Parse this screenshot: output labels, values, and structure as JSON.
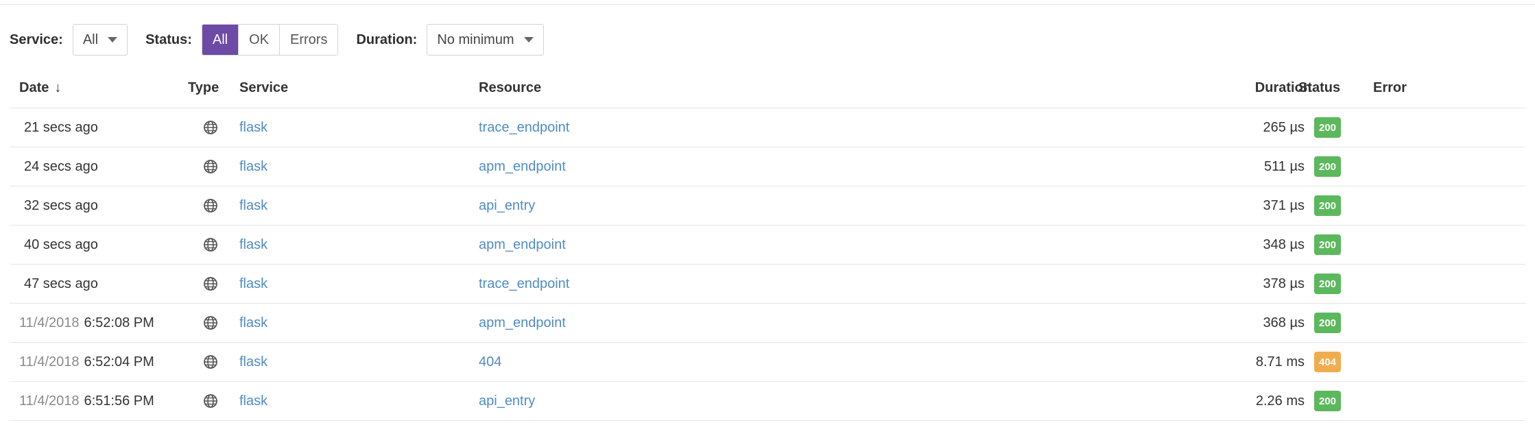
{
  "filters": {
    "service": {
      "label": "Service:",
      "value": "All"
    },
    "status": {
      "label": "Status:",
      "options": [
        "All",
        "OK",
        "Errors"
      ],
      "selected": "All"
    },
    "duration": {
      "label": "Duration:",
      "value": "No minimum"
    }
  },
  "colors": {
    "accent": "#6c4aa5",
    "link": "#4f8bc4",
    "status_ok": "#5cb85c",
    "status_warn": "#f0ad4e"
  },
  "table": {
    "headers": {
      "date": "Date",
      "date_sort": "↓",
      "type": "Type",
      "service": "Service",
      "resource": "Resource",
      "duration": "Duration",
      "status": "Status",
      "error": "Error"
    },
    "rows": [
      {
        "date_prefix": "",
        "date_main": "21 secs ago",
        "type_icon": "globe-icon",
        "service": "flask",
        "resource": "trace_endpoint",
        "duration": "265 µs",
        "status": "200",
        "status_color": "#5cb85c",
        "error": ""
      },
      {
        "date_prefix": "",
        "date_main": "24 secs ago",
        "type_icon": "globe-icon",
        "service": "flask",
        "resource": "apm_endpoint",
        "duration": "511 µs",
        "status": "200",
        "status_color": "#5cb85c",
        "error": ""
      },
      {
        "date_prefix": "",
        "date_main": "32 secs ago",
        "type_icon": "globe-icon",
        "service": "flask",
        "resource": "api_entry",
        "duration": "371 µs",
        "status": "200",
        "status_color": "#5cb85c",
        "error": ""
      },
      {
        "date_prefix": "",
        "date_main": "40 secs ago",
        "type_icon": "globe-icon",
        "service": "flask",
        "resource": "apm_endpoint",
        "duration": "348 µs",
        "status": "200",
        "status_color": "#5cb85c",
        "error": ""
      },
      {
        "date_prefix": "",
        "date_main": "47 secs ago",
        "type_icon": "globe-icon",
        "service": "flask",
        "resource": "trace_endpoint",
        "duration": "378 µs",
        "status": "200",
        "status_color": "#5cb85c",
        "error": ""
      },
      {
        "date_prefix": "11/4/2018",
        "date_main": "6:52:08 PM",
        "type_icon": "globe-icon",
        "service": "flask",
        "resource": "apm_endpoint",
        "duration": "368 µs",
        "status": "200",
        "status_color": "#5cb85c",
        "error": ""
      },
      {
        "date_prefix": "11/4/2018",
        "date_main": "6:52:04 PM",
        "type_icon": "globe-icon",
        "service": "flask",
        "resource": "404",
        "duration": "8.71 ms",
        "status": "404",
        "status_color": "#f0ad4e",
        "error": ""
      },
      {
        "date_prefix": "11/4/2018",
        "date_main": "6:51:56 PM",
        "type_icon": "globe-icon",
        "service": "flask",
        "resource": "api_entry",
        "duration": "2.26 ms",
        "status": "200",
        "status_color": "#5cb85c",
        "error": ""
      }
    ]
  }
}
